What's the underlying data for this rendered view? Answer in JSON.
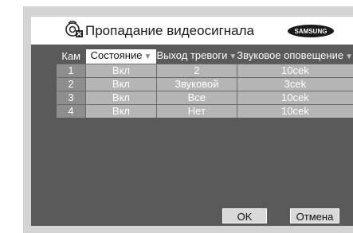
{
  "title": "Пропадание видеосигнала",
  "brand": "SAMSUNG",
  "columns": [
    {
      "label": "Кам",
      "arrow": ""
    },
    {
      "label": "Состояние",
      "arrow": "▼"
    },
    {
      "label": "Выход тревоги",
      "arrow": "▼"
    },
    {
      "label": "Звуковое оповещение",
      "arrow": "▼"
    }
  ],
  "rows": [
    {
      "cam": "1",
      "state": "Вкл",
      "alarm": "2",
      "sound": "10cek"
    },
    {
      "cam": "2",
      "state": "Вкл",
      "alarm": "Звуковой",
      "sound": "3cek"
    },
    {
      "cam": "3",
      "state": "Вкл",
      "alarm": "Все",
      "sound": "10cek"
    },
    {
      "cam": "4",
      "state": "Вкл",
      "alarm": "Нет",
      "sound": "10cek"
    }
  ],
  "buttons": {
    "ok": "OK",
    "cancel": "Отмена"
  },
  "colors": {
    "panel": "#5a5a5a",
    "cell": "#b5b5b5",
    "cam_cell": "#8e8e8e",
    "selected_header": "#ffffff"
  },
  "icons": {
    "title": "video-loss-camera-icon"
  }
}
